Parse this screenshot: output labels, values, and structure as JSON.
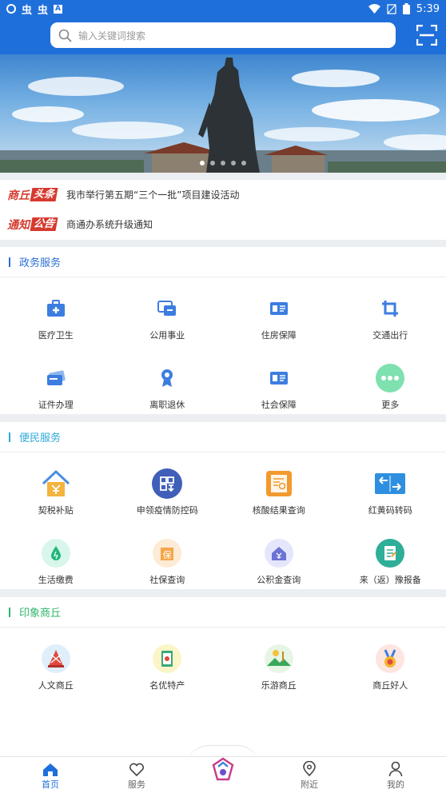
{
  "status": {
    "time": "5:39"
  },
  "search": {
    "placeholder": "输入关键词搜索"
  },
  "news": [
    {
      "tag1": "商丘",
      "tag2": "头条",
      "text": "我市举行第五期“三个一批”项目建设活动"
    },
    {
      "tag1": "通知",
      "tag2": "公告",
      "text": "商通办系统升级通知"
    }
  ],
  "sections": {
    "gov": {
      "title": "政务服务",
      "color": "#2b6fd6",
      "items": [
        {
          "label": "医疗卫生",
          "icon": "medical-kit-icon"
        },
        {
          "label": "公用事业",
          "icon": "utility-icon"
        },
        {
          "label": "住房保障",
          "icon": "housing-id-icon"
        },
        {
          "label": "交通出行",
          "icon": "crop-icon"
        },
        {
          "label": "证件办理",
          "icon": "card-icon"
        },
        {
          "label": "离职退休",
          "icon": "medal-icon"
        },
        {
          "label": "社会保障",
          "icon": "id-card-icon"
        },
        {
          "label": "更多",
          "icon": "more-icon"
        }
      ]
    },
    "life": {
      "title": "便民服务",
      "color": "#2ea8d8",
      "items": [
        {
          "label": "契税补贴",
          "icon": "house-yuan-icon"
        },
        {
          "label": "申领疫情防控码",
          "icon": "qr-code-icon"
        },
        {
          "label": "核酸结果查询",
          "icon": "report-search-icon"
        },
        {
          "label": "红黄码转码",
          "icon": "transfer-icon"
        },
        {
          "label": "生活缴费",
          "icon": "water-drop-icon"
        },
        {
          "label": "社保查询",
          "icon": "insurance-icon"
        },
        {
          "label": "公积金查询",
          "icon": "fund-house-icon"
        },
        {
          "label": "来（返）豫报备",
          "icon": "clipboard-icon"
        }
      ]
    },
    "impression": {
      "title": "印象商丘",
      "color": "#2fb56a",
      "items": [
        {
          "label": "人文商丘",
          "icon": "culture-icon"
        },
        {
          "label": "名优特产",
          "icon": "specialty-icon"
        },
        {
          "label": "乐游商丘",
          "icon": "travel-icon"
        },
        {
          "label": "商丘好人",
          "icon": "good-person-medal-icon"
        }
      ]
    }
  },
  "tabs": [
    {
      "label": "首页",
      "icon": "home-icon",
      "active": true
    },
    {
      "label": "服务",
      "icon": "heart-icon",
      "active": false
    },
    {
      "label": "",
      "icon": "center-logo-icon",
      "active": false
    },
    {
      "label": "附近",
      "icon": "location-icon",
      "active": false
    },
    {
      "label": "我的",
      "icon": "user-icon",
      "active": false
    }
  ]
}
